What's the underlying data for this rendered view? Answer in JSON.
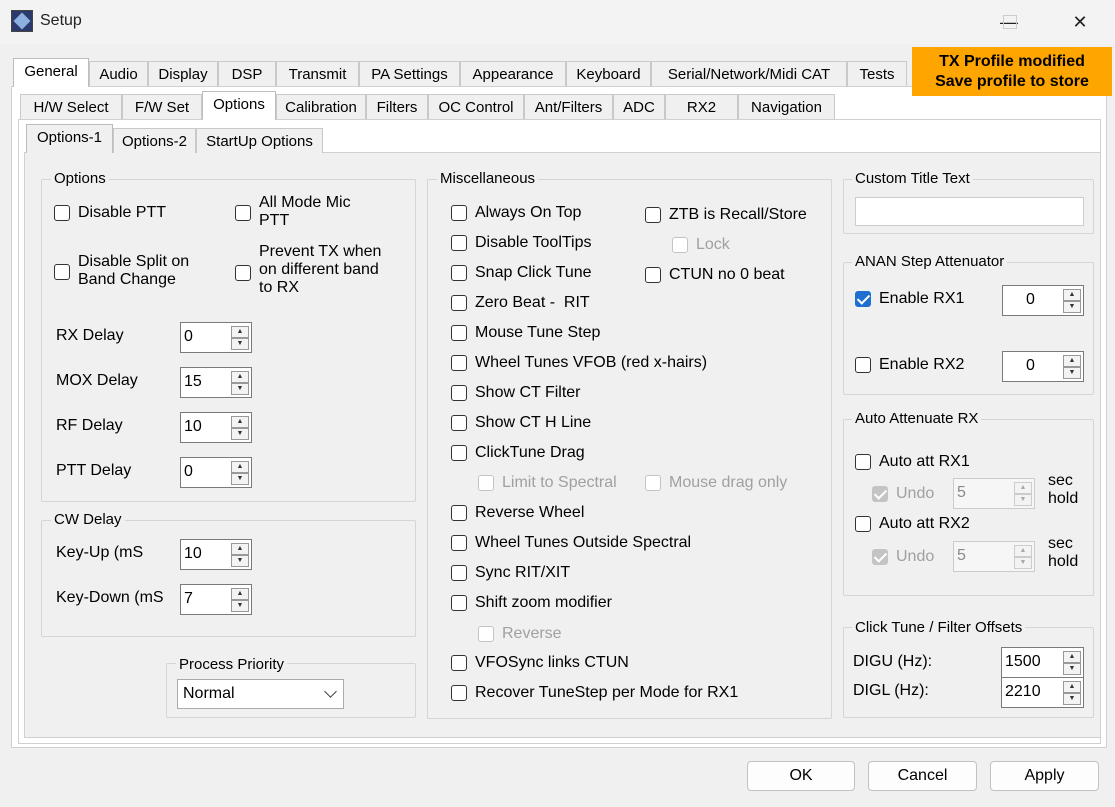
{
  "window": {
    "title": "Setup",
    "accent": "#1f6fd1",
    "warning_color": "#ffa500"
  },
  "main_tabs": [
    "General",
    "Audio",
    "Display",
    "DSP",
    "Transmit",
    "PA Settings",
    "Appearance",
    "Keyboard",
    "Serial/Network/Midi CAT",
    "Tests"
  ],
  "warning": {
    "line1": "TX Profile modified",
    "line2": "Save profile to store"
  },
  "sub_tabs": [
    "H/W Select",
    "F/W Set",
    "Options",
    "Calibration",
    "Filters",
    "OC Control",
    "Ant/Filters",
    "ADC",
    "RX2",
    "Navigation"
  ],
  "options_tabs": [
    "Options-1",
    "Options-2",
    "StartUp Options"
  ],
  "options_group": {
    "title": "Options",
    "disable_ptt": "Disable PTT",
    "all_mode_mic_ptt": [
      "All Mode Mic",
      "PTT"
    ],
    "disable_split": [
      "Disable Split on",
      "Band Change"
    ],
    "prevent_tx": [
      "Prevent TX when",
      "on different band",
      "to RX"
    ],
    "rx_delay": {
      "label": "RX Delay",
      "value": "0"
    },
    "mox_delay": {
      "label": "MOX Delay",
      "value": "15"
    },
    "rf_delay": {
      "label": "RF Delay",
      "value": "10"
    },
    "ptt_delay": {
      "label": "PTT Delay",
      "value": "0"
    }
  },
  "cw_group": {
    "title": "CW Delay",
    "key_up": {
      "label": "Key-Up (mS",
      "value": "10"
    },
    "key_down": {
      "label": "Key-Down (mS",
      "value": "7"
    }
  },
  "process_priority": {
    "title": "Process Priority",
    "value": "Normal"
  },
  "misc_group": {
    "title": "Miscellaneous",
    "always_on_top": "Always On Top",
    "disable_tooltips": "Disable ToolTips",
    "snap_click_tune": "Snap Click Tune",
    "zero_beat": "Zero Beat -  RIT",
    "mouse_tune_step": "Mouse Tune Step",
    "wheel_tunes_vfob": "Wheel Tunes VFOB (red x-hairs)",
    "show_ct_filter": "Show CT Filter",
    "show_ct_h_line": "Show CT H Line",
    "clicktune_drag": "ClickTune Drag",
    "limit_to_spectral": "Limit to Spectral",
    "mouse_drag_only": "Mouse drag only",
    "reverse_wheel": "Reverse Wheel",
    "wheel_tunes_outside": "Wheel Tunes Outside Spectral",
    "sync_rit_xit": "Sync RIT/XIT",
    "shift_zoom": "Shift zoom modifier",
    "reverse": "Reverse",
    "vfosync": "VFOSync links CTUN",
    "recover_tunestep": "Recover TuneStep per Mode for RX1",
    "ztb": "ZTB is Recall/Store",
    "lock": "Lock",
    "ctun_no_0_beat": "CTUN no 0 beat"
  },
  "custom_title": {
    "title": "Custom Title Text",
    "value": ""
  },
  "anan": {
    "title": "ANAN Step Attenuator",
    "enable_rx1": {
      "label": "Enable RX1",
      "checked": true,
      "value": "0"
    },
    "enable_rx2": {
      "label": "Enable RX2",
      "checked": false,
      "value": "0"
    }
  },
  "auto_att": {
    "title": "Auto Attenuate RX",
    "rx1": "Auto att RX1",
    "rx2": "Auto att RX2",
    "undo": "Undo",
    "undo_value": "5",
    "sec": "sec",
    "hold": "hold"
  },
  "offsets": {
    "title": "Click Tune / Filter Offsets",
    "digu": {
      "label": "DIGU (Hz):",
      "value": "1500"
    },
    "digl": {
      "label": "DIGL (Hz):",
      "value": "2210"
    }
  },
  "buttons": {
    "ok": "OK",
    "cancel": "Cancel",
    "apply": "Apply"
  }
}
